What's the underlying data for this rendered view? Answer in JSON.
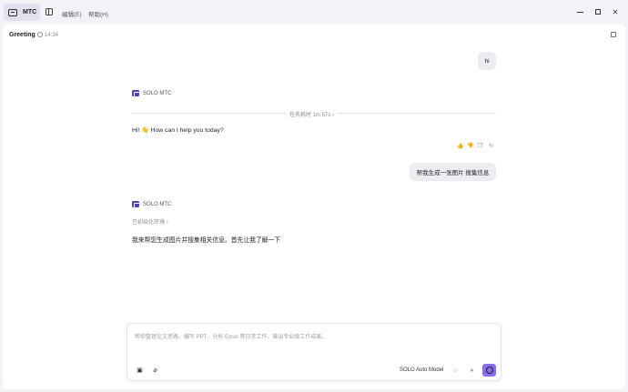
{
  "titlebar": {
    "app_tab_label": "MTC",
    "menu": [
      "编辑(E)",
      "帮助(H)"
    ]
  },
  "header": {
    "title": "Greeting",
    "time": "14:34"
  },
  "chat": {
    "user_message_1": "hi",
    "agent_name_1": "SOLO MTC",
    "duration": "任务耗时 1m 57s",
    "duration_chevron": "›",
    "agent_reply_1": "Hi! 👋 How can I help you today?",
    "user_message_2": "帮我生成一张图片 搜集信息",
    "agent_name_2": "SOLO MTC",
    "status_text": "已初始化环境",
    "status_chevron": "›",
    "agent_reply_2": "我来帮您生成图片并搜集相关信息。首先让我了解一下"
  },
  "composer": {
    "placeholder": "帮你整理论文思路、编写 PPT、分析 Excel 等日常工作，输出专业级工作成果。",
    "model_label": "SOLO Auto Model"
  },
  "icons": {
    "accent": "#8b6cf0",
    "agent_badge": "#5a3fb3"
  }
}
